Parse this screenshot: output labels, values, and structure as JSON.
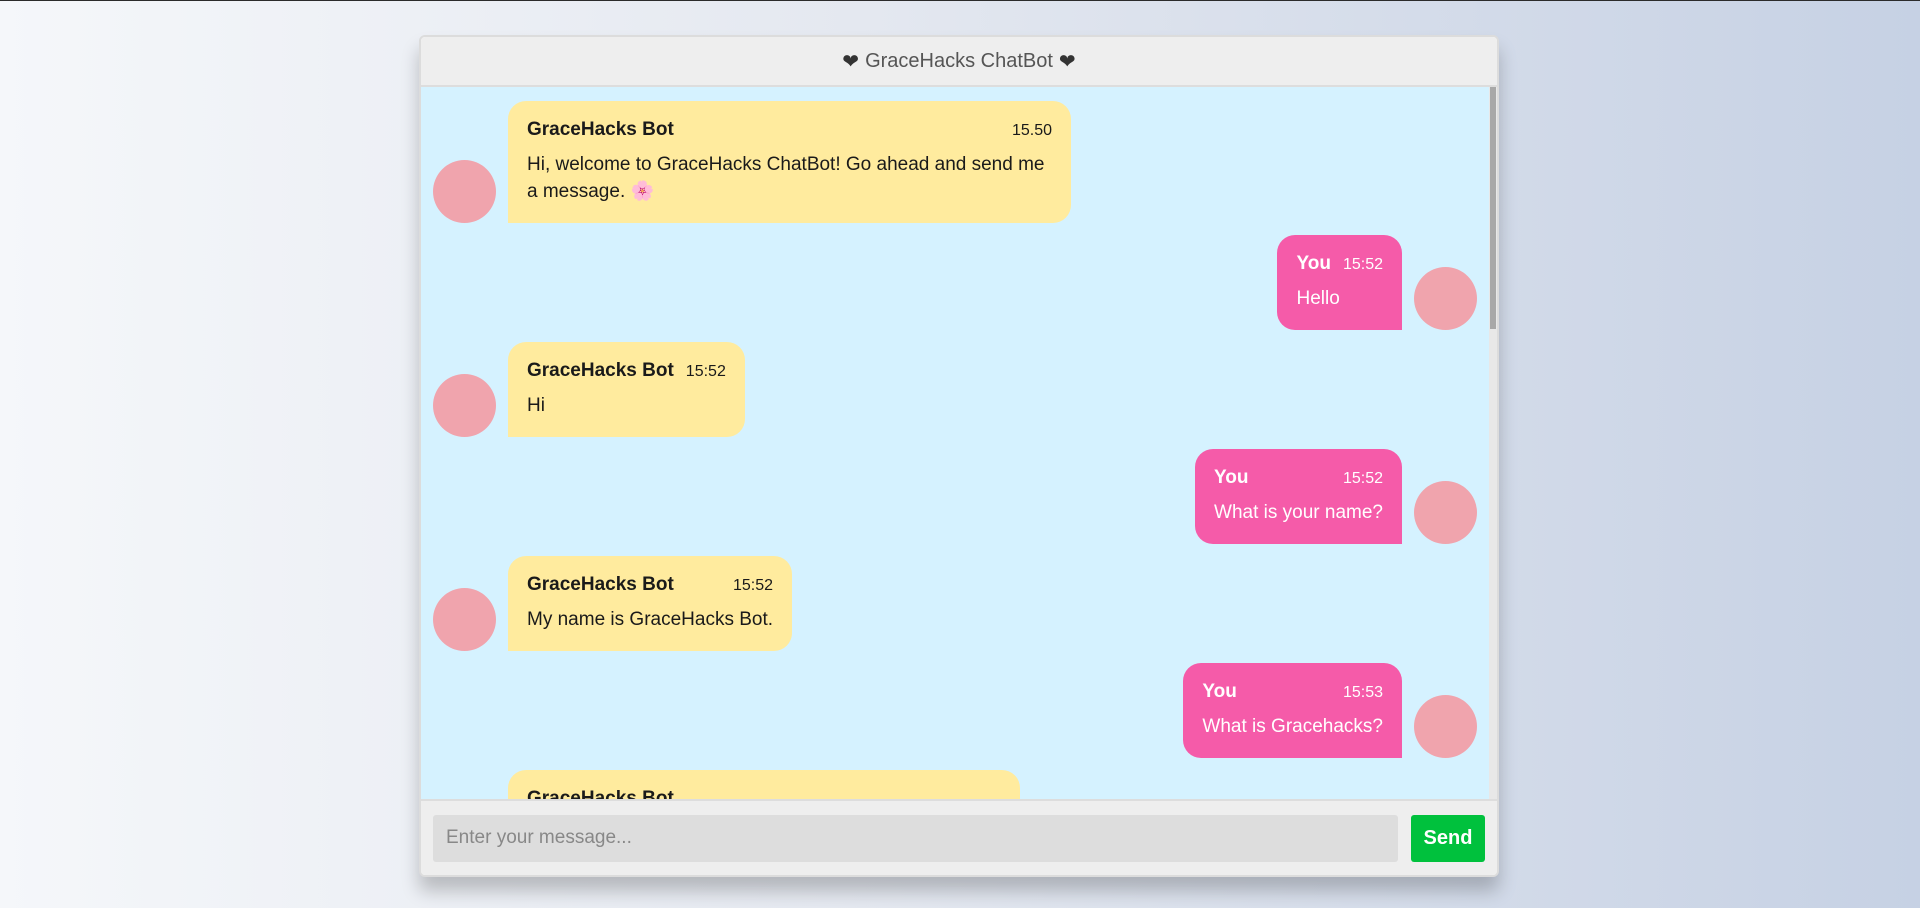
{
  "header": {
    "title": "GraceHacks ChatBot",
    "heart_left": "❤",
    "heart_right": "❤"
  },
  "messages": [
    {
      "side": "left",
      "sender": "GraceHacks Bot",
      "time": "15.50",
      "text": "Hi, welcome to GraceHacks ChatBot! Go ahead and send me a message. 🌸"
    },
    {
      "side": "right",
      "sender": "You",
      "time": "15:52",
      "text": "Hello"
    },
    {
      "side": "left",
      "sender": "GraceHacks Bot",
      "time": "15:52",
      "text": "Hi"
    },
    {
      "side": "right",
      "sender": "You",
      "time": "15:52",
      "text": "What is your name?"
    },
    {
      "side": "left",
      "sender": "GraceHacks Bot",
      "time": "15:52",
      "text": "My name is GraceHacks Bot."
    },
    {
      "side": "right",
      "sender": "You",
      "time": "15:53",
      "text": "What is Gracehacks?"
    },
    {
      "side": "left",
      "sender": "GraceHacks Bot",
      "time": "",
      "text": ""
    }
  ],
  "composer": {
    "placeholder": "Enter your message...",
    "value": "",
    "send_label": "Send"
  },
  "colors": {
    "bot_bubble": "#ffeb9e",
    "user_bubble": "#f55ba9",
    "chat_background": "#d5f2ff",
    "avatar": "#f0a4ad",
    "send_button": "#00c13d"
  }
}
